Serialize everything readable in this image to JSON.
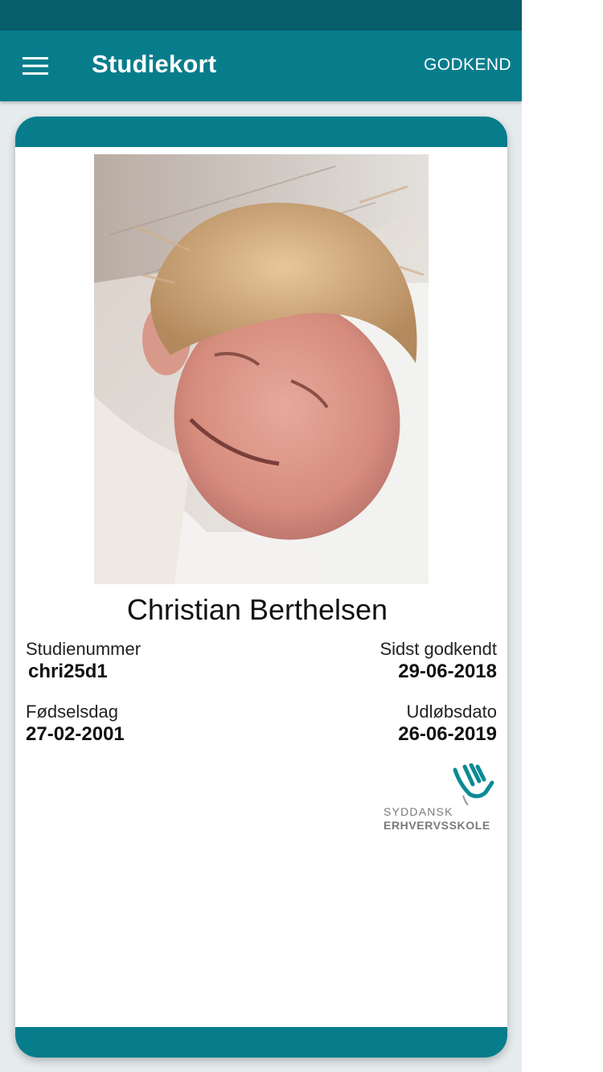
{
  "app_bar": {
    "title": "Studiekort",
    "approve_label": "GODKEND",
    "menu_icon": "hamburger-menu-icon"
  },
  "card": {
    "student_name": "Christian Berthelsen",
    "photo_icon": "student-photo",
    "fields": {
      "student_number_label": "Studienummer",
      "student_number_value": "chri25d1",
      "last_approved_label": "Sidst godkendt",
      "last_approved_value": "29-06-2018",
      "birthday_label": "Fødselsdag",
      "birthday_value": "27-02-2001",
      "expiry_label": "Udløbsdato",
      "expiry_value": "26-06-2019"
    },
    "logo": {
      "line1": "SYDDANSK",
      "line2": "ERHVERVSSKOLE",
      "icon": "hand-logo-icon"
    }
  },
  "colors": {
    "status_bar": "#075e6b",
    "primary": "#077d8c",
    "background": "#e6ecee"
  }
}
